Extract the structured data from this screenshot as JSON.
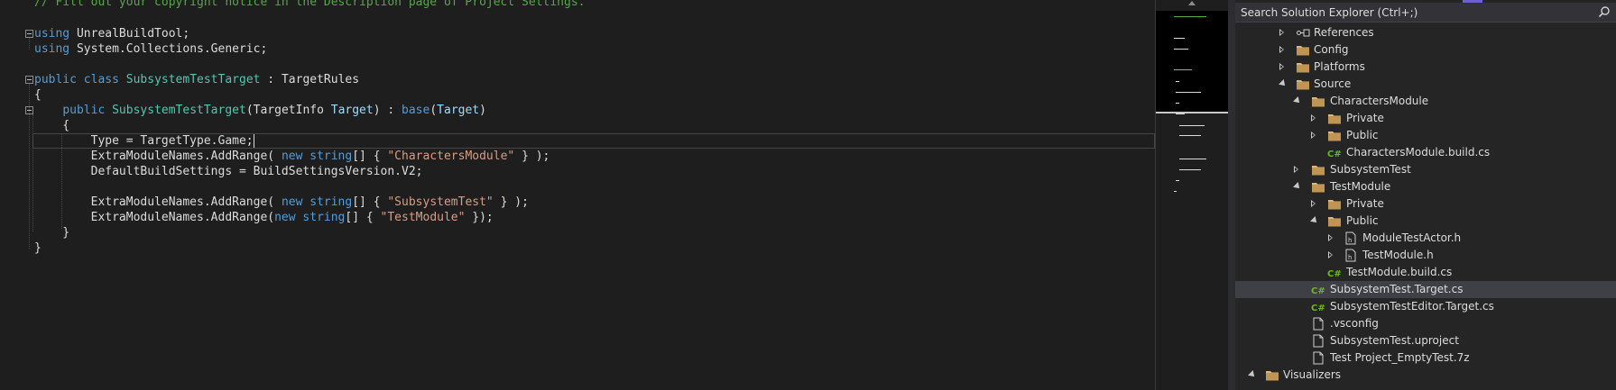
{
  "editor": {
    "lines": [
      [
        {
          "t": "// Fill out your copyright notice in the Description page of Project Settings.",
          "c": "cm"
        }
      ],
      [],
      [
        {
          "t": "using",
          "c": "kw"
        },
        {
          "t": " UnrealBuildTool;"
        }
      ],
      [
        {
          "t": "using",
          "c": "kw"
        },
        {
          "t": " System.Collections.Generic;"
        }
      ],
      [],
      [
        {
          "t": "public",
          "c": "kw"
        },
        {
          "t": " "
        },
        {
          "t": "class",
          "c": "kw"
        },
        {
          "t": " "
        },
        {
          "t": "SubsystemTestTarget",
          "c": "ty"
        },
        {
          "t": " : TargetRules"
        }
      ],
      [
        {
          "t": "{"
        }
      ],
      [
        {
          "t": "    "
        },
        {
          "t": "public",
          "c": "kw"
        },
        {
          "t": " "
        },
        {
          "t": "SubsystemTestTarget",
          "c": "ty"
        },
        {
          "t": "(TargetInfo "
        },
        {
          "t": "Target",
          "c": "pm"
        },
        {
          "t": ") : "
        },
        {
          "t": "base",
          "c": "kw"
        },
        {
          "t": "("
        },
        {
          "t": "Target",
          "c": "pm"
        },
        {
          "t": ")"
        }
      ],
      [
        {
          "t": "    {"
        }
      ],
      [
        {
          "t": "        Type = TargetType.Game;"
        }
      ],
      [
        {
          "t": "        ExtraModuleNames.AddRange( "
        },
        {
          "t": "new",
          "c": "kw"
        },
        {
          "t": " "
        },
        {
          "t": "string",
          "c": "kw"
        },
        {
          "t": "[] { "
        },
        {
          "t": "\"CharactersModule\"",
          "c": "st"
        },
        {
          "t": " } );"
        }
      ],
      [
        {
          "t": "        DefaultBuildSettings = BuildSettingsVersion.V2;"
        }
      ],
      [],
      [
        {
          "t": "        ExtraModuleNames.AddRange( "
        },
        {
          "t": "new",
          "c": "kw"
        },
        {
          "t": " "
        },
        {
          "t": "string",
          "c": "kw"
        },
        {
          "t": "[] { "
        },
        {
          "t": "\"SubsystemTest\"",
          "c": "st"
        },
        {
          "t": " } );"
        }
      ],
      [
        {
          "t": "        ExtraModuleNames.AddRange("
        },
        {
          "t": "new",
          "c": "kw"
        },
        {
          "t": " "
        },
        {
          "t": "string",
          "c": "kw"
        },
        {
          "t": "[] { "
        },
        {
          "t": "\"TestModule\"",
          "c": "st"
        },
        {
          "t": " });"
        }
      ],
      [
        {
          "t": "    }"
        }
      ],
      [
        {
          "t": "}"
        }
      ]
    ]
  },
  "colors": {
    "keyword": "#569cd6",
    "type": "#4ec9b0",
    "string": "#d69d85",
    "comment": "#57a64a",
    "text": "#dcdcdc",
    "folder": "#dcb67a",
    "csharp": "#68b723"
  },
  "solution_explorer": {
    "search_placeholder": "Search Solution Explorer (Ctrl+;)",
    "items": [
      {
        "label": "References",
        "depth": 2,
        "arrow": "collapsed",
        "icon": "references-icon"
      },
      {
        "label": "Config",
        "depth": 2,
        "arrow": "collapsed",
        "icon": "folder-icon"
      },
      {
        "label": "Platforms",
        "depth": 2,
        "arrow": "collapsed",
        "icon": "folder-icon"
      },
      {
        "label": "Source",
        "depth": 2,
        "arrow": "expanded",
        "icon": "folder-icon"
      },
      {
        "label": "CharactersModule",
        "depth": 3,
        "arrow": "expanded",
        "icon": "folder-icon"
      },
      {
        "label": "Private",
        "depth": 4,
        "arrow": "collapsed",
        "icon": "folder-icon"
      },
      {
        "label": "Public",
        "depth": 4,
        "arrow": "collapsed",
        "icon": "folder-icon"
      },
      {
        "label": "CharactersModule.build.cs",
        "depth": 4,
        "arrow": "none",
        "icon": "csharp-file-icon"
      },
      {
        "label": "SubsystemTest",
        "depth": 3,
        "arrow": "collapsed",
        "icon": "folder-icon"
      },
      {
        "label": "TestModule",
        "depth": 3,
        "arrow": "expanded",
        "icon": "folder-icon"
      },
      {
        "label": "Private",
        "depth": 4,
        "arrow": "collapsed",
        "icon": "folder-icon"
      },
      {
        "label": "Public",
        "depth": 4,
        "arrow": "expanded",
        "icon": "folder-icon"
      },
      {
        "label": "ModuleTestActor.h",
        "depth": 5,
        "arrow": "collapsed",
        "icon": "header-file-icon"
      },
      {
        "label": "TestModule.h",
        "depth": 5,
        "arrow": "collapsed",
        "icon": "header-file-icon"
      },
      {
        "label": "TestModule.build.cs",
        "depth": 4,
        "arrow": "none",
        "icon": "csharp-file-icon"
      },
      {
        "label": "SubsystemTest.Target.cs",
        "depth": 3,
        "arrow": "none",
        "icon": "csharp-file-icon",
        "selected": true
      },
      {
        "label": "SubsystemTestEditor.Target.cs",
        "depth": 3,
        "arrow": "none",
        "icon": "csharp-file-icon"
      },
      {
        "label": ".vsconfig",
        "depth": 3,
        "arrow": "none",
        "icon": "file-icon"
      },
      {
        "label": "SubsystemTest.uproject",
        "depth": 3,
        "arrow": "none",
        "icon": "file-icon"
      },
      {
        "label": "Test Project_EmptyTest.7z",
        "depth": 3,
        "arrow": "none",
        "icon": "file-icon"
      },
      {
        "label": "Visualizers",
        "depth": 1,
        "arrow": "expanded",
        "icon": "folder-icon"
      }
    ]
  }
}
